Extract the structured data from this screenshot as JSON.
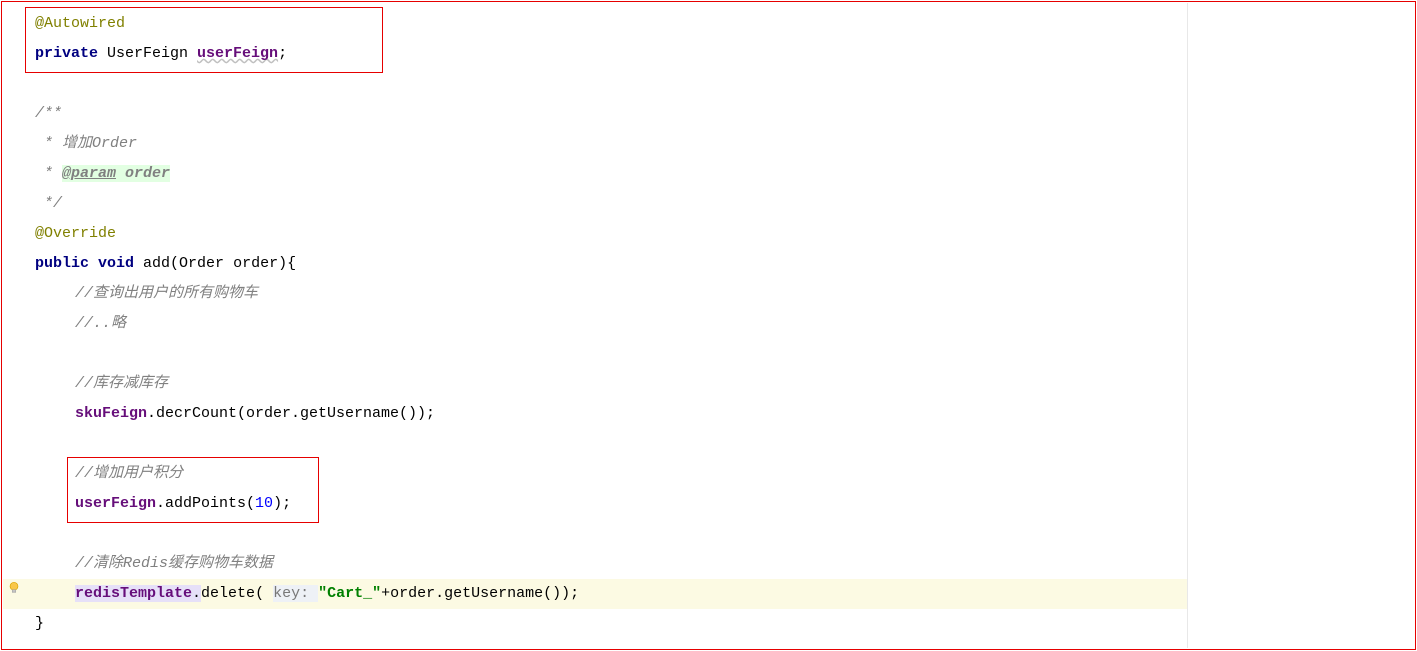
{
  "code": {
    "l1_anno": "@Autowired",
    "l2_kw": "private",
    "l2_type": " UserFeign ",
    "l2_field": "userFeign",
    "l2_semi": ";",
    "l4_doc_open": "/**",
    "l5_doc": " * 增加Order",
    "l6_doc_star": " * ",
    "l6_tag": "@param",
    "l6_sp": " ",
    "l6_param": "order",
    "l7_doc_close": " */",
    "l8_anno": "@Override",
    "l9_kw1": "public",
    "l9_sp1": " ",
    "l9_kw2": "void",
    "l9_rest": " add(Order order){",
    "l10_c": "//查询出用户的所有购物车",
    "l11_c": "//..略",
    "l13_c": "//库存减库存",
    "l14_field": "skuFeign",
    "l14_rest": ".decrCount(order.getUsername());",
    "l16_c": "//增加用户积分",
    "l17_field": "userFeign",
    "l17_dot": ".addPoints(",
    "l17_num": "10",
    "l17_end": ");",
    "l19_c": "//清除Redis缓存购物车数据",
    "l20_field": "redisTemplate",
    "l20_dot": ".",
    "l20_method": "delete",
    "l20_paren": "( ",
    "l20_hint": "key: ",
    "l20_str": "\"Cart_\"",
    "l20_rest": "+order.getUsername());",
    "l21": "}"
  },
  "icons": {
    "bulb": "intention-bulb-icon"
  }
}
